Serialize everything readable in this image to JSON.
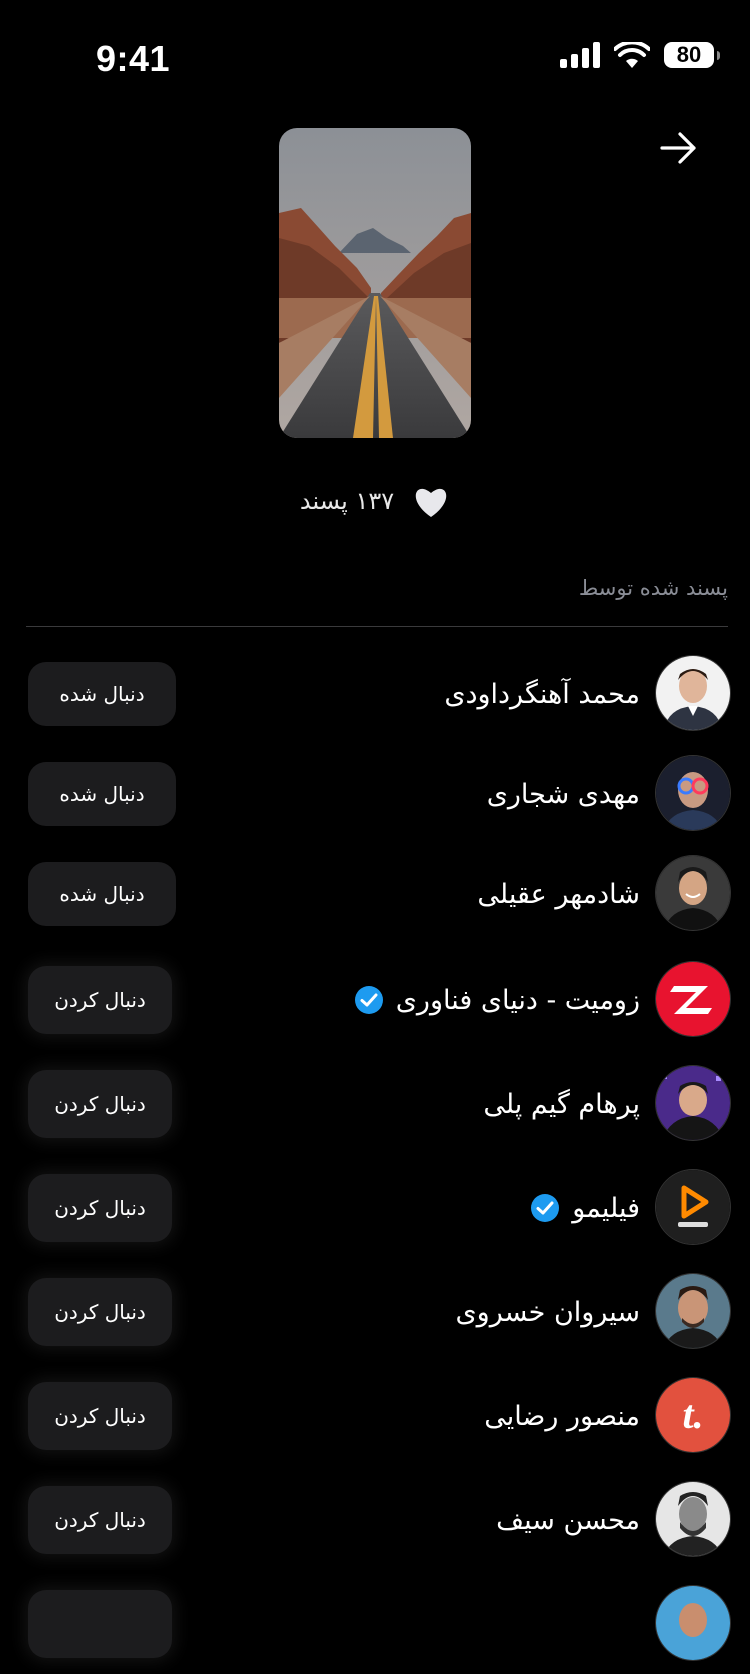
{
  "status": {
    "time": "9:41",
    "battery": "80"
  },
  "post": {
    "likes_text": "۱۳۷ پسند"
  },
  "section": {
    "title": "پسند شده توسط"
  },
  "colors": {
    "background": "#000000",
    "button": "#1c1c1e",
    "verified": "#1d9bf0",
    "muted": "#8a8d96"
  },
  "users": [
    {
      "name": "محمد آهنگرداودی",
      "button": "دنبال شده",
      "verified": false
    },
    {
      "name": "مهدی شجاری",
      "button": "دنبال شده",
      "verified": false
    },
    {
      "name": "شادمهر عقیلی",
      "button": "دنبال شده",
      "verified": false
    },
    {
      "name": "زومیت - دنیای فناوری",
      "button": "دنبال کردن",
      "verified": true
    },
    {
      "name": "پرهام گیم پلی",
      "button": "دنبال کردن",
      "verified": false
    },
    {
      "name": "فیلیمو",
      "button": "دنبال کردن",
      "verified": true
    },
    {
      "name": "سیروان خسروی",
      "button": "دنبال کردن",
      "verified": false
    },
    {
      "name": "منصور رضایی",
      "button": "دنبال کردن",
      "verified": false
    },
    {
      "name": "محسن سیف",
      "button": "دنبال کردن",
      "verified": false
    },
    {
      "name": "",
      "button": "",
      "verified": false
    }
  ]
}
